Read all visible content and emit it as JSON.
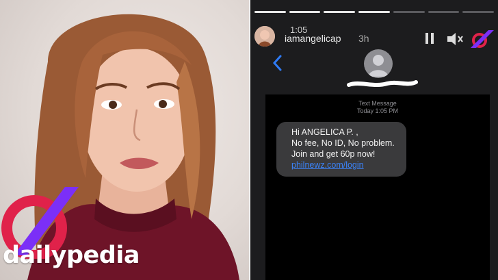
{
  "brand": {
    "name": "dailypedia",
    "colors": {
      "accent": "#7b2ff7",
      "accent2": "#e0224a"
    }
  },
  "story": {
    "time": "1:05",
    "username": "iamangelicap",
    "age": "3h",
    "progress_segments": 7,
    "active_segment": 4
  },
  "message": {
    "type_label": "Text Message",
    "date_label": "Today 1:05 PM",
    "lines": [
      "Hi ANGELICA P. ,",
      "No fee, No ID, No problem.",
      "Join and get 60p now!"
    ],
    "link": "philnewz.com/login"
  }
}
